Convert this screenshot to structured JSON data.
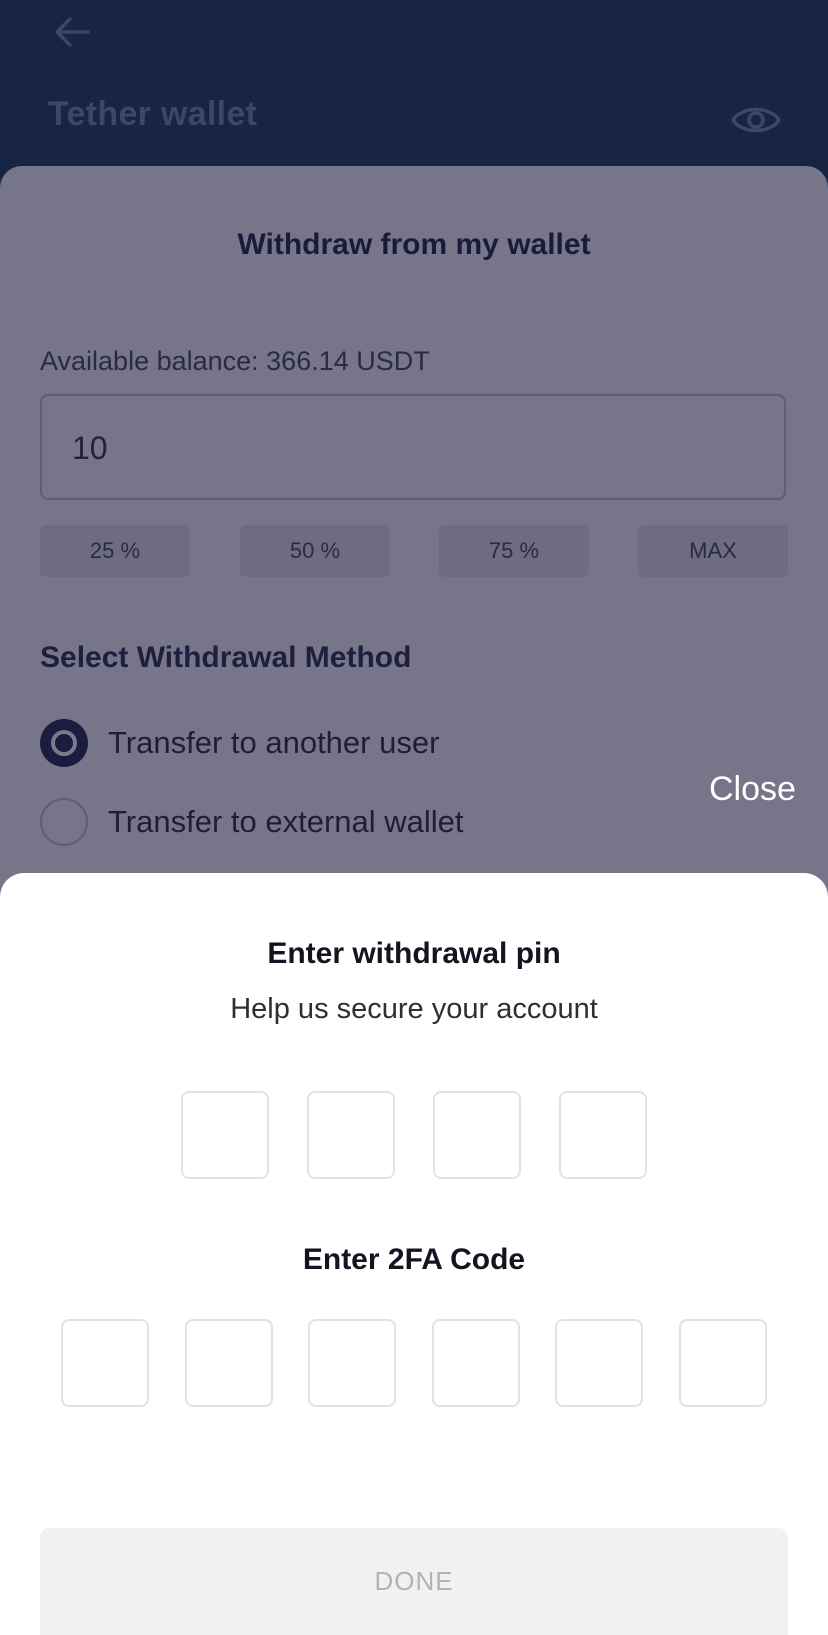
{
  "header": {
    "title": "Tether wallet",
    "back_icon": "arrow-left-icon",
    "visibility_icon": "eye-icon"
  },
  "withdraw": {
    "title": "Withdraw from my wallet",
    "available_balance": "Available balance: 366.14 USDT",
    "amount_value": "10",
    "quick_amounts": [
      "25 %",
      "50 %",
      "75 %",
      "MAX"
    ],
    "method_heading": "Select Withdrawal Method",
    "methods": [
      {
        "label": "Transfer to another user",
        "selected": true
      },
      {
        "label": "Transfer to external wallet",
        "selected": false
      }
    ],
    "close_label": "Close"
  },
  "pin_modal": {
    "title": "Enter withdrawal pin",
    "subtitle": "Help us secure your account",
    "pin_length": 4,
    "twofa_title": "Enter 2FA Code",
    "twofa_length": 6,
    "done_label": "DONE"
  },
  "colors": {
    "header_bg": "#182443",
    "sheet_overlay": "#767589",
    "accent_dark": "#1d1b40",
    "modal_bg": "#ffffff",
    "done_disabled_bg": "#f1f1f1"
  }
}
